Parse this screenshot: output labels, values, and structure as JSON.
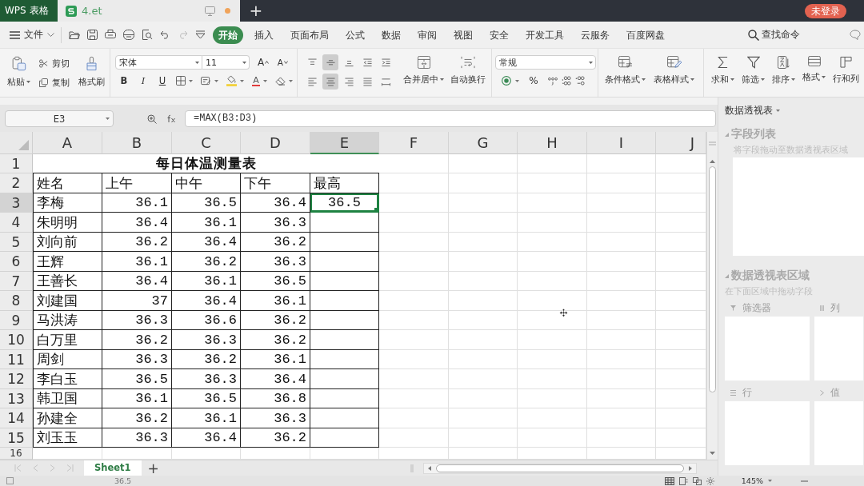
{
  "title_bar": {
    "app_name": "WPS 表格",
    "document_tab": {
      "name": "4.et",
      "modified": true
    },
    "new_tab": "+",
    "login_button": "未登录"
  },
  "menu_bar": {
    "file_menu": "文件",
    "tabs": [
      {
        "label": "开始",
        "selected": true
      },
      {
        "label": "插入",
        "selected": false
      },
      {
        "label": "页面布局",
        "selected": false
      },
      {
        "label": "公式",
        "selected": false
      },
      {
        "label": "数据",
        "selected": false
      },
      {
        "label": "审阅",
        "selected": false
      },
      {
        "label": "视图",
        "selected": false
      },
      {
        "label": "安全",
        "selected": false
      },
      {
        "label": "开发工具",
        "selected": false
      },
      {
        "label": "云服务",
        "selected": false
      },
      {
        "label": "百度网盘",
        "selected": false
      }
    ],
    "search": "查找命令"
  },
  "ribbon": {
    "clipboard": {
      "paste": "粘贴",
      "cut": "剪切",
      "copy": "复制",
      "format_painter": "格式刷"
    },
    "font": {
      "font_name": "宋体",
      "font_size": "11",
      "grow": "A",
      "shrink": "A",
      "bold": "B",
      "italic": "I",
      "underline": "U",
      "font_color": "A"
    },
    "alignment": [
      {
        "kind": "top",
        "selected": false
      },
      {
        "kind": "middle",
        "selected": true
      },
      {
        "kind": "bottom",
        "selected": false
      },
      {
        "kind": "outdent",
        "selected": false
      },
      {
        "kind": "indent",
        "selected": false
      },
      {
        "kind": "left",
        "selected": false
      },
      {
        "kind": "center",
        "selected": true
      },
      {
        "kind": "right",
        "selected": false
      },
      {
        "kind": "justify",
        "selected": false
      },
      {
        "kind": "distributed",
        "selected": false
      }
    ],
    "merge_center": "合并居中",
    "wrap_text": "自动换行",
    "number": {
      "format": "常规",
      "percent": "%"
    },
    "styles": {
      "conditional_format": "条件格式",
      "table_style": "表格样式"
    },
    "editing": {
      "sum": "求和",
      "filter": "筛选",
      "sort": "排序",
      "format": "格式",
      "rows_columns": "行和列"
    }
  },
  "formula_bar": {
    "name_box": "E3",
    "formula": "=MAX(B3:D3)"
  },
  "sheet": {
    "columns": [
      {
        "label": "A",
        "selected": false
      },
      {
        "label": "B",
        "selected": false
      },
      {
        "label": "C",
        "selected": false
      },
      {
        "label": "D",
        "selected": false
      },
      {
        "label": "E",
        "selected": true
      },
      {
        "label": "F",
        "selected": false
      },
      {
        "label": "G",
        "selected": false
      },
      {
        "label": "H",
        "selected": false
      },
      {
        "label": "I",
        "selected": false
      },
      {
        "label": "J",
        "selected": false
      }
    ],
    "rows": [
      {
        "number": "1",
        "selected": false,
        "kind": "title",
        "cells": [
          {
            "text": "每日体温测量表",
            "selected": false
          }
        ]
      },
      {
        "number": "2",
        "selected": false,
        "kind": "header",
        "cells": [
          {
            "text": "姓名",
            "selected": false
          },
          {
            "text": "上午",
            "selected": false
          },
          {
            "text": "中午",
            "selected": false
          },
          {
            "text": "下午",
            "selected": false
          },
          {
            "text": "最高",
            "selected": false
          }
        ]
      },
      {
        "number": "3",
        "selected": true,
        "kind": "data",
        "cells": [
          {
            "text": "李梅",
            "selected": false
          },
          {
            "text": "36.1",
            "selected": false
          },
          {
            "text": "36.5",
            "selected": false
          },
          {
            "text": "36.4",
            "selected": false
          },
          {
            "text": "36.5",
            "selected": true
          }
        ]
      },
      {
        "number": "4",
        "selected": false,
        "kind": "data",
        "cells": [
          {
            "text": "朱明明",
            "selected": false
          },
          {
            "text": "36.4",
            "selected": false
          },
          {
            "text": "36.1",
            "selected": false
          },
          {
            "text": "36.3",
            "selected": false
          },
          {
            "selected": false
          }
        ]
      },
      {
        "number": "5",
        "selected": false,
        "kind": "data",
        "cells": [
          {
            "text": "刘向前",
            "selected": false
          },
          {
            "text": "36.2",
            "selected": false
          },
          {
            "text": "36.4",
            "selected": false
          },
          {
            "text": "36.2",
            "selected": false
          },
          {
            "selected": false
          }
        ]
      },
      {
        "number": "6",
        "selected": false,
        "kind": "data",
        "cells": [
          {
            "text": "王辉",
            "selected": false
          },
          {
            "text": "36.1",
            "selected": false
          },
          {
            "text": "36.2",
            "selected": false
          },
          {
            "text": "36.3",
            "selected": false
          },
          {
            "selected": false
          }
        ]
      },
      {
        "number": "7",
        "selected": false,
        "kind": "data",
        "cells": [
          {
            "text": "王善长",
            "selected": false
          },
          {
            "text": "36.4",
            "selected": false
          },
          {
            "text": "36.1",
            "selected": false
          },
          {
            "text": "36.5",
            "selected": false
          },
          {
            "selected": false
          }
        ]
      },
      {
        "number": "8",
        "selected": false,
        "kind": "data",
        "cells": [
          {
            "text": "刘建国",
            "selected": false
          },
          {
            "text": "37",
            "selected": false
          },
          {
            "text": "36.4",
            "selected": false
          },
          {
            "text": "36.1",
            "selected": false
          },
          {
            "selected": false
          }
        ]
      },
      {
        "number": "9",
        "selected": false,
        "kind": "data",
        "cells": [
          {
            "text": "马洪涛",
            "selected": false
          },
          {
            "text": "36.3",
            "selected": false
          },
          {
            "text": "36.6",
            "selected": false
          },
          {
            "text": "36.2",
            "selected": false
          },
          {
            "selected": false
          }
        ]
      },
      {
        "number": "10",
        "selected": false,
        "kind": "data",
        "cells": [
          {
            "text": "白万里",
            "selected": false
          },
          {
            "text": "36.2",
            "selected": false
          },
          {
            "text": "36.3",
            "selected": false
          },
          {
            "text": "36.2",
            "selected": false
          },
          {
            "selected": false
          }
        ]
      },
      {
        "number": "11",
        "selected": false,
        "kind": "data",
        "cells": [
          {
            "text": "周剑",
            "selected": false
          },
          {
            "text": "36.3",
            "selected": false
          },
          {
            "text": "36.2",
            "selected": false
          },
          {
            "text": "36.1",
            "selected": false
          },
          {
            "selected": false
          }
        ]
      },
      {
        "number": "12",
        "selected": false,
        "kind": "data",
        "cells": [
          {
            "text": "李白玉",
            "selected": false
          },
          {
            "text": "36.5",
            "selected": false
          },
          {
            "text": "36.3",
            "selected": false
          },
          {
            "text": "36.4",
            "selected": false
          },
          {
            "selected": false
          }
        ]
      },
      {
        "number": "13",
        "selected": false,
        "kind": "data",
        "cells": [
          {
            "text": "韩卫国",
            "selected": false
          },
          {
            "text": "36.1",
            "selected": false
          },
          {
            "text": "36.5",
            "selected": false
          },
          {
            "text": "36.8",
            "selected": false
          },
          {
            "selected": false
          }
        ]
      },
      {
        "number": "14",
        "selected": false,
        "kind": "data",
        "cells": [
          {
            "text": "孙建全",
            "selected": false
          },
          {
            "text": "36.2",
            "selected": false
          },
          {
            "text": "36.1",
            "selected": false
          },
          {
            "text": "36.3",
            "selected": false
          },
          {
            "selected": false
          }
        ]
      },
      {
        "number": "15",
        "selected": false,
        "kind": "data",
        "cells": [
          {
            "text": "刘玉玉",
            "selected": false
          },
          {
            "text": "36.3",
            "selected": false
          },
          {
            "text": "36.4",
            "selected": false
          },
          {
            "text": "36.2",
            "selected": false
          },
          {
            "selected": false
          }
        ]
      },
      {
        "number": "16",
        "selected": false,
        "kind": "blank"
      }
    ]
  },
  "sheet_tabs": {
    "tabs": [
      {
        "label": "Sheet1",
        "selected": true
      }
    ],
    "add_sheet": "+"
  },
  "pivot_panel": {
    "title": "数据透视表",
    "field_list": {
      "heading": "字段列表",
      "hint": "将字段拖动至数据透视表区域"
    },
    "areas": {
      "heading": "数据透视表区域",
      "hint": "在下面区域中拖动字段",
      "zones": [
        {
          "kind": "filter",
          "label": "筛选器"
        },
        {
          "kind": "column",
          "label": "列"
        },
        {
          "kind": "row",
          "label": "行"
        },
        {
          "kind": "value",
          "label": "值"
        }
      ]
    }
  },
  "status_bar": {
    "cell_value": "36.5",
    "zoom": "145%"
  }
}
